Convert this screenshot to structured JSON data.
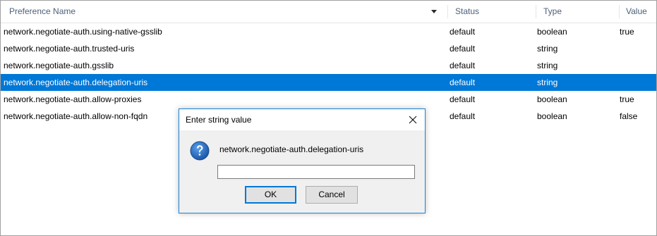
{
  "header": {
    "columns": [
      {
        "label": "Preference Name"
      },
      {
        "label": "Status"
      },
      {
        "label": "Type"
      },
      {
        "label": "Value"
      }
    ]
  },
  "rows": [
    {
      "name": "network.negotiate-auth.using-native-gsslib",
      "status": "default",
      "type": "boolean",
      "value": "true"
    },
    {
      "name": "network.negotiate-auth.trusted-uris",
      "status": "default",
      "type": "string",
      "value": ""
    },
    {
      "name": "network.negotiate-auth.gsslib",
      "status": "default",
      "type": "string",
      "value": ""
    },
    {
      "name": "network.negotiate-auth.delegation-uris",
      "status": "default",
      "type": "string",
      "value": ""
    },
    {
      "name": "network.negotiate-auth.allow-proxies",
      "status": "default",
      "type": "boolean",
      "value": "true"
    },
    {
      "name": "network.negotiate-auth.allow-non-fqdn",
      "status": "default",
      "type": "boolean",
      "value": "false"
    }
  ],
  "selected_row_index": 3,
  "dialog": {
    "title": "Enter string value",
    "message": "network.negotiate-auth.delegation-uris",
    "input_value": "",
    "ok_label": "OK",
    "cancel_label": "Cancel",
    "icon": "question-icon",
    "close_icon": "close-icon"
  },
  "colors": {
    "selection": "#0078d7",
    "dialog_border": "#1883d7",
    "header_text": "#4c607a",
    "question_icon": "#1c63b7"
  }
}
